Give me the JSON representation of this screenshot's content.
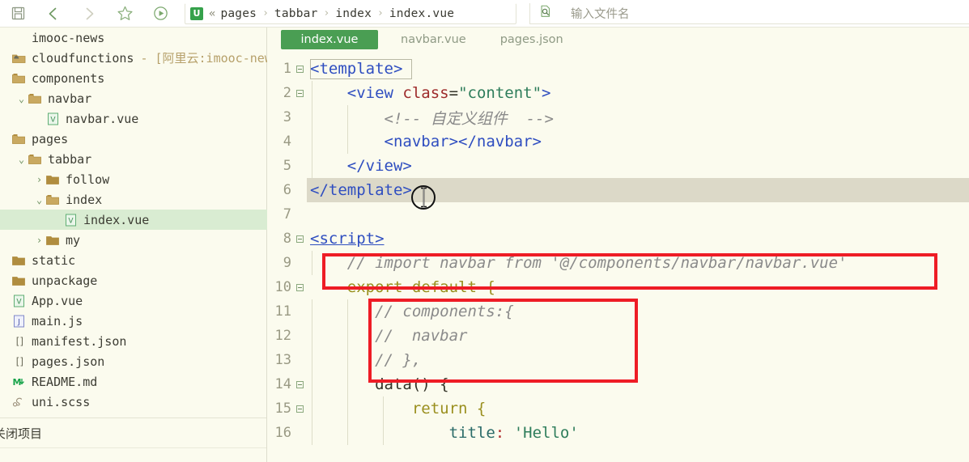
{
  "toolbar": {
    "icons": [
      {
        "name": "save-icon",
        "label": "保存"
      },
      {
        "name": "back-chevron-icon",
        "label": "后退"
      },
      {
        "name": "forward-chevron-icon",
        "label": "前进"
      },
      {
        "name": "star-icon",
        "label": "收藏"
      },
      {
        "name": "run-play-icon",
        "label": "运行"
      }
    ],
    "breadcrumb": {
      "badge": "U",
      "chevrons": "«",
      "items": [
        "pages",
        "tabbar",
        "index",
        "index.vue"
      ],
      "separator": "›"
    },
    "filename_search": {
      "icon": "file-search-icon",
      "placeholder": "输入文件名",
      "value": ""
    }
  },
  "sidebar": {
    "tree": [
      {
        "label": "imooc-news",
        "icon": "none",
        "arrow": "none",
        "indent": 0,
        "selected": false,
        "suffix": ""
      },
      {
        "label": "cloudfunctions",
        "icon": "cloud-folder-icon",
        "arrow": "none",
        "indent": 0,
        "selected": false,
        "suffix": "- [阿里云:imooc-news]"
      },
      {
        "label": "components",
        "icon": "folder-icon",
        "arrow": "none",
        "indent": 0,
        "selected": false,
        "suffix": ""
      },
      {
        "label": "navbar",
        "icon": "folder-open-icon",
        "arrow": "down",
        "indent": 1,
        "selected": false,
        "suffix": ""
      },
      {
        "label": "navbar.vue",
        "icon": "vue-file-icon",
        "arrow": "none",
        "indent": 2,
        "selected": false,
        "suffix": ""
      },
      {
        "label": "pages",
        "icon": "folder-icon",
        "arrow": "none",
        "indent": 0,
        "selected": false,
        "suffix": ""
      },
      {
        "label": "tabbar",
        "icon": "folder-open-icon",
        "arrow": "down",
        "indent": 1,
        "selected": false,
        "suffix": ""
      },
      {
        "label": "follow",
        "icon": "folder-closed-icon",
        "arrow": "right",
        "indent": 2,
        "selected": false,
        "suffix": ""
      },
      {
        "label": "index",
        "icon": "folder-open-icon",
        "arrow": "down",
        "indent": 2,
        "selected": false,
        "suffix": ""
      },
      {
        "label": "index.vue",
        "icon": "vue-file-icon",
        "arrow": "none",
        "indent": 3,
        "selected": true,
        "suffix": ""
      },
      {
        "label": "my",
        "icon": "folder-closed-icon",
        "arrow": "right",
        "indent": 2,
        "selected": false,
        "suffix": ""
      },
      {
        "label": "static",
        "icon": "folder-closed-icon",
        "arrow": "none",
        "indent": 0,
        "selected": false,
        "suffix": ""
      },
      {
        "label": "unpackage",
        "icon": "folder-closed-icon",
        "arrow": "none",
        "indent": 0,
        "selected": false,
        "suffix": ""
      },
      {
        "label": "App.vue",
        "icon": "vue-file-icon",
        "arrow": "none",
        "indent": 0,
        "selected": false,
        "suffix": ""
      },
      {
        "label": "main.js",
        "icon": "js-file-icon",
        "arrow": "none",
        "indent": 0,
        "selected": false,
        "suffix": ""
      },
      {
        "label": "manifest.json",
        "icon": "json-file-icon",
        "arrow": "none",
        "indent": 0,
        "selected": false,
        "suffix": ""
      },
      {
        "label": "pages.json",
        "icon": "json-file-icon",
        "arrow": "none",
        "indent": 0,
        "selected": false,
        "suffix": ""
      },
      {
        "label": "README.md",
        "icon": "md-file-icon",
        "arrow": "none",
        "indent": 0,
        "selected": false,
        "suffix": ""
      },
      {
        "label": "uni.scss",
        "icon": "scss-file-icon",
        "arrow": "none",
        "indent": 0,
        "selected": false,
        "suffix": ""
      }
    ],
    "footer_label": "关闭项目"
  },
  "editor": {
    "tabs": [
      {
        "label": "index.vue",
        "active": true
      },
      {
        "label": "navbar.vue",
        "active": false
      },
      {
        "label": "pages.json",
        "active": false
      }
    ],
    "lines": [
      {
        "num": "1",
        "fold": true
      },
      {
        "num": "2",
        "fold": true
      },
      {
        "num": "3",
        "fold": false
      },
      {
        "num": "4",
        "fold": false
      },
      {
        "num": "5",
        "fold": false
      },
      {
        "num": "6",
        "fold": false
      },
      {
        "num": "7",
        "fold": false
      },
      {
        "num": "8",
        "fold": true
      },
      {
        "num": "9",
        "fold": false
      },
      {
        "num": "10",
        "fold": true
      },
      {
        "num": "11",
        "fold": false
      },
      {
        "num": "12",
        "fold": false
      },
      {
        "num": "13",
        "fold": false
      },
      {
        "num": "14",
        "fold": true
      },
      {
        "num": "15",
        "fold": true
      },
      {
        "num": "16",
        "fold": false
      }
    ],
    "code": {
      "l1_template_open": "<template>",
      "l2_view_open_a": "<view ",
      "l2_view_class": "class",
      "l2_view_eq": "=",
      "l2_view_val": "\"content\"",
      "l2_view_gt": ">",
      "l3_comment": "<!-- 自定义组件  -->",
      "l4_navbar": "<navbar></navbar>",
      "l5_view_close": "</view>",
      "l6_template_close": "</template>",
      "l7_blank": "",
      "l8_script_open": "<script>",
      "l9_comment": "// import navbar from '@/components/navbar/navbar.vue'",
      "l10_export": "export default {",
      "l11_comment": "// components:{",
      "l12_comment": "//  navbar",
      "l13_comment": "// },",
      "l14_data": "data() {",
      "l15_return": "return {",
      "l16_title_key": "title",
      "l16_colon": ":",
      "l16_title_val": "'Hello'"
    },
    "highlight_line": "6",
    "annotations": [
      {
        "name": "import-line-highlight"
      },
      {
        "name": "components-block-highlight"
      }
    ],
    "annotation_color": "#ee1c25"
  },
  "colors": {
    "accent_green": "#4a9e53",
    "editor_bg": "#fbfbee",
    "selection_green": "#d9ecd2",
    "annotation_red": "#ee1c25",
    "tag_blue": "#2f4ec0",
    "string_green": "#2e7d5b",
    "comment_grey": "#8a8a8a",
    "keyword_olive": "#9a8f1e"
  }
}
